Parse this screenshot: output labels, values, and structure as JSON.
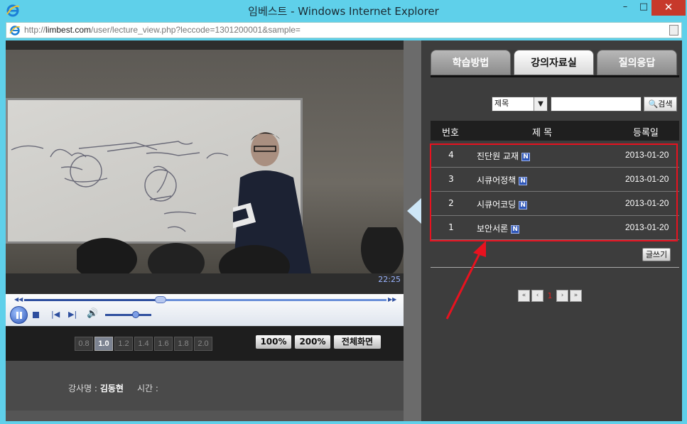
{
  "window": {
    "title": "임베스트 - Windows Internet Explorer",
    "minimize": "–",
    "maximize": "□",
    "close": "✕"
  },
  "address": {
    "domain": "limbest.com",
    "prefix": "http://",
    "path": "/user/lecture_view.php?leccode=1301200001&sample="
  },
  "player": {
    "time": "22:25",
    "speeds": [
      "0.8",
      "1.0",
      "1.2",
      "1.4",
      "1.6",
      "1.8",
      "2.0"
    ],
    "active_speed": "1.0",
    "seek_progress": 0.36,
    "volume_level": 0.6,
    "zoom_100": "100%",
    "zoom_200": "200%",
    "fullscreen": "전체화면",
    "instructor_label": "강사명 :",
    "instructor_name": "김동현",
    "time_label": "시간 :"
  },
  "panel": {
    "tabs": [
      "학습방법",
      "강의자료실",
      "질의응답"
    ],
    "active_tab": "강의자료실",
    "search": {
      "select_value": "제목",
      "input_value": "",
      "button_label": "검색"
    },
    "table": {
      "headers": [
        "번호",
        "제 목",
        "등록일"
      ],
      "rows": [
        {
          "no": "4",
          "title": "진단원 교재",
          "badge": "N",
          "date": "2013-01-20"
        },
        {
          "no": "3",
          "title": "시큐어정책",
          "badge": "N",
          "date": "2013-01-20"
        },
        {
          "no": "2",
          "title": "시큐어코딩",
          "badge": "N",
          "date": "2013-01-20"
        },
        {
          "no": "1",
          "title": "보안서론",
          "badge": "N",
          "date": "2013-01-20"
        }
      ]
    },
    "write_button": "글쓰기",
    "pager": {
      "first": "«",
      "prev": "‹",
      "current": "1",
      "next": "›",
      "last": "»"
    }
  },
  "colors": {
    "annotation": "#e8121f",
    "titlebar": "#5fd0ea"
  }
}
